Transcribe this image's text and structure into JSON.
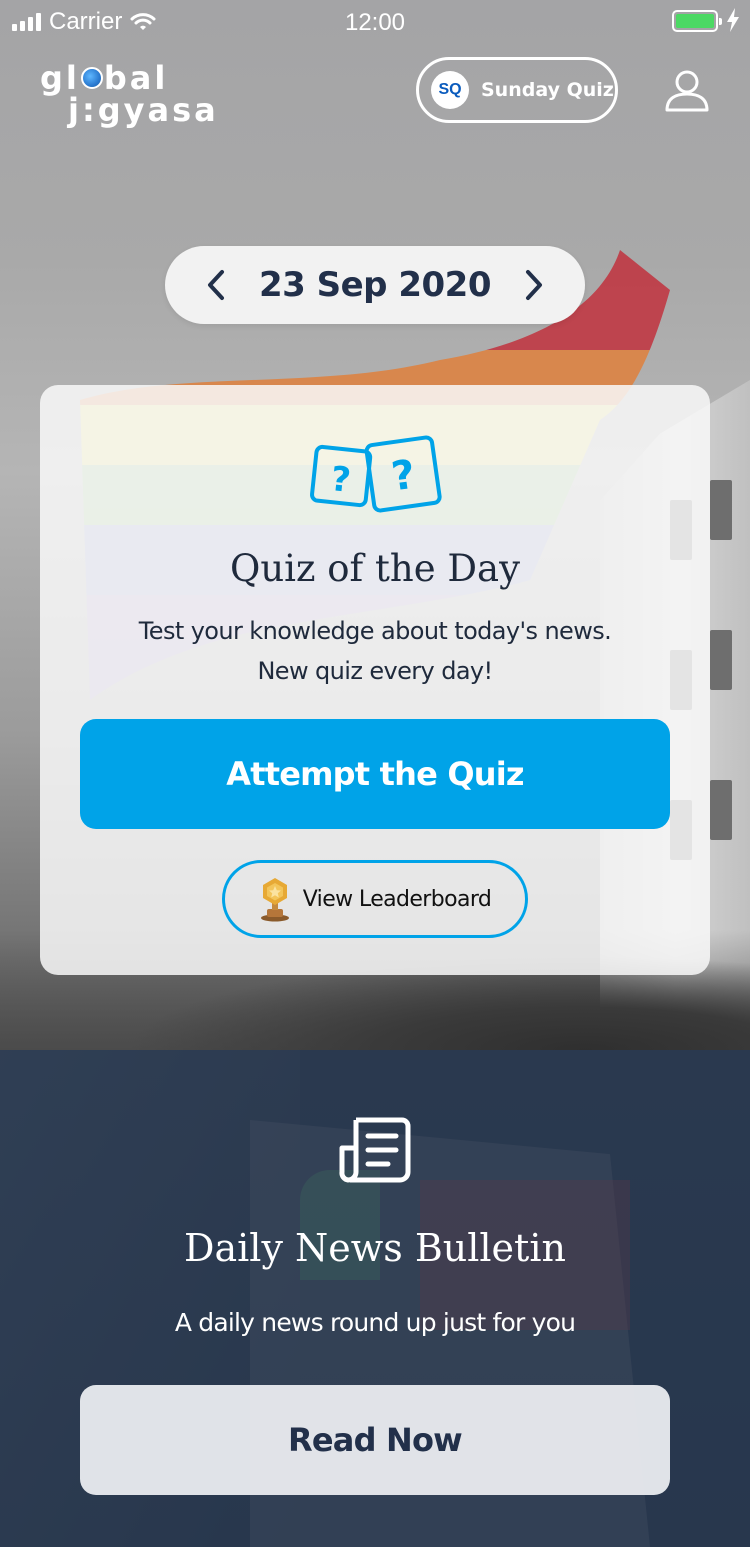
{
  "status_bar": {
    "carrier": "Carrier",
    "time": "12:00",
    "signal_icon": "signal-bars-icon",
    "wifi_icon": "wifi-icon",
    "battery_icon": "battery-icon",
    "battery_level": 1.0,
    "battery_color": "#4cd964"
  },
  "header": {
    "logo_line1": "global",
    "logo_line2": "jigyasa",
    "sunday_quiz": {
      "badge": "SQ",
      "label": "Sunday Quiz"
    },
    "profile_icon": "user-icon"
  },
  "date_selector": {
    "date": "23 Sep 2020",
    "prev_icon": "chevron-left-icon",
    "next_icon": "chevron-right-icon"
  },
  "quiz_card": {
    "icon": "question-dice-icon",
    "title": "Quiz of the Day",
    "description_line1": "Test your knowledge about today's news.",
    "description_line2": "New quiz every day!",
    "attempt_button": "Attempt the Quiz",
    "leaderboard_button": "View Leaderboard",
    "leaderboard_icon": "trophy-icon"
  },
  "news_section": {
    "icon": "document-icon",
    "title": "Daily News Bulletin",
    "description": "A daily news round up just for you",
    "read_button": "Read Now"
  },
  "colors": {
    "accent": "#00a3e8",
    "dark_text": "#22304a",
    "news_bg": "#2f3f55"
  }
}
